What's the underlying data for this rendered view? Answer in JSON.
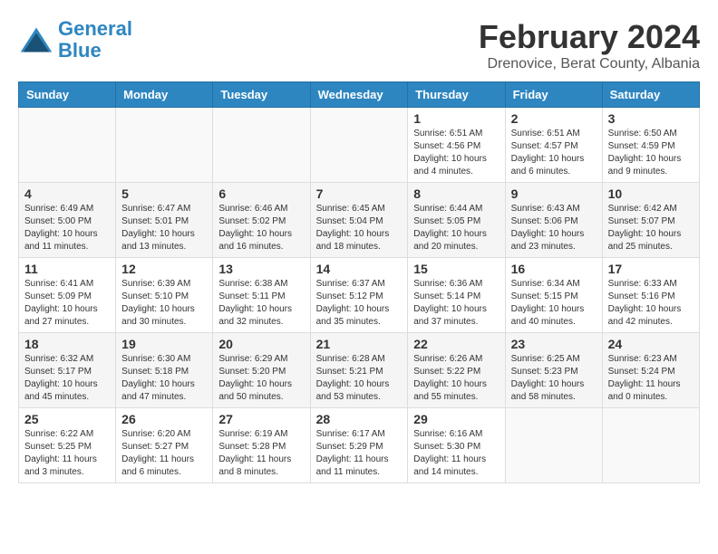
{
  "header": {
    "logo_line1": "General",
    "logo_line2": "Blue",
    "month": "February 2024",
    "location": "Drenovice, Berat County, Albania"
  },
  "weekdays": [
    "Sunday",
    "Monday",
    "Tuesday",
    "Wednesday",
    "Thursday",
    "Friday",
    "Saturday"
  ],
  "weeks": [
    [
      {
        "day": "",
        "info": ""
      },
      {
        "day": "",
        "info": ""
      },
      {
        "day": "",
        "info": ""
      },
      {
        "day": "",
        "info": ""
      },
      {
        "day": "1",
        "info": "Sunrise: 6:51 AM\nSunset: 4:56 PM\nDaylight: 10 hours\nand 4 minutes."
      },
      {
        "day": "2",
        "info": "Sunrise: 6:51 AM\nSunset: 4:57 PM\nDaylight: 10 hours\nand 6 minutes."
      },
      {
        "day": "3",
        "info": "Sunrise: 6:50 AM\nSunset: 4:59 PM\nDaylight: 10 hours\nand 9 minutes."
      }
    ],
    [
      {
        "day": "4",
        "info": "Sunrise: 6:49 AM\nSunset: 5:00 PM\nDaylight: 10 hours\nand 11 minutes."
      },
      {
        "day": "5",
        "info": "Sunrise: 6:47 AM\nSunset: 5:01 PM\nDaylight: 10 hours\nand 13 minutes."
      },
      {
        "day": "6",
        "info": "Sunrise: 6:46 AM\nSunset: 5:02 PM\nDaylight: 10 hours\nand 16 minutes."
      },
      {
        "day": "7",
        "info": "Sunrise: 6:45 AM\nSunset: 5:04 PM\nDaylight: 10 hours\nand 18 minutes."
      },
      {
        "day": "8",
        "info": "Sunrise: 6:44 AM\nSunset: 5:05 PM\nDaylight: 10 hours\nand 20 minutes."
      },
      {
        "day": "9",
        "info": "Sunrise: 6:43 AM\nSunset: 5:06 PM\nDaylight: 10 hours\nand 23 minutes."
      },
      {
        "day": "10",
        "info": "Sunrise: 6:42 AM\nSunset: 5:07 PM\nDaylight: 10 hours\nand 25 minutes."
      }
    ],
    [
      {
        "day": "11",
        "info": "Sunrise: 6:41 AM\nSunset: 5:09 PM\nDaylight: 10 hours\nand 27 minutes."
      },
      {
        "day": "12",
        "info": "Sunrise: 6:39 AM\nSunset: 5:10 PM\nDaylight: 10 hours\nand 30 minutes."
      },
      {
        "day": "13",
        "info": "Sunrise: 6:38 AM\nSunset: 5:11 PM\nDaylight: 10 hours\nand 32 minutes."
      },
      {
        "day": "14",
        "info": "Sunrise: 6:37 AM\nSunset: 5:12 PM\nDaylight: 10 hours\nand 35 minutes."
      },
      {
        "day": "15",
        "info": "Sunrise: 6:36 AM\nSunset: 5:14 PM\nDaylight: 10 hours\nand 37 minutes."
      },
      {
        "day": "16",
        "info": "Sunrise: 6:34 AM\nSunset: 5:15 PM\nDaylight: 10 hours\nand 40 minutes."
      },
      {
        "day": "17",
        "info": "Sunrise: 6:33 AM\nSunset: 5:16 PM\nDaylight: 10 hours\nand 42 minutes."
      }
    ],
    [
      {
        "day": "18",
        "info": "Sunrise: 6:32 AM\nSunset: 5:17 PM\nDaylight: 10 hours\nand 45 minutes."
      },
      {
        "day": "19",
        "info": "Sunrise: 6:30 AM\nSunset: 5:18 PM\nDaylight: 10 hours\nand 47 minutes."
      },
      {
        "day": "20",
        "info": "Sunrise: 6:29 AM\nSunset: 5:20 PM\nDaylight: 10 hours\nand 50 minutes."
      },
      {
        "day": "21",
        "info": "Sunrise: 6:28 AM\nSunset: 5:21 PM\nDaylight: 10 hours\nand 53 minutes."
      },
      {
        "day": "22",
        "info": "Sunrise: 6:26 AM\nSunset: 5:22 PM\nDaylight: 10 hours\nand 55 minutes."
      },
      {
        "day": "23",
        "info": "Sunrise: 6:25 AM\nSunset: 5:23 PM\nDaylight: 10 hours\nand 58 minutes."
      },
      {
        "day": "24",
        "info": "Sunrise: 6:23 AM\nSunset: 5:24 PM\nDaylight: 11 hours\nand 0 minutes."
      }
    ],
    [
      {
        "day": "25",
        "info": "Sunrise: 6:22 AM\nSunset: 5:25 PM\nDaylight: 11 hours\nand 3 minutes."
      },
      {
        "day": "26",
        "info": "Sunrise: 6:20 AM\nSunset: 5:27 PM\nDaylight: 11 hours\nand 6 minutes."
      },
      {
        "day": "27",
        "info": "Sunrise: 6:19 AM\nSunset: 5:28 PM\nDaylight: 11 hours\nand 8 minutes."
      },
      {
        "day": "28",
        "info": "Sunrise: 6:17 AM\nSunset: 5:29 PM\nDaylight: 11 hours\nand 11 minutes."
      },
      {
        "day": "29",
        "info": "Sunrise: 6:16 AM\nSunset: 5:30 PM\nDaylight: 11 hours\nand 14 minutes."
      },
      {
        "day": "",
        "info": ""
      },
      {
        "day": "",
        "info": ""
      }
    ]
  ]
}
